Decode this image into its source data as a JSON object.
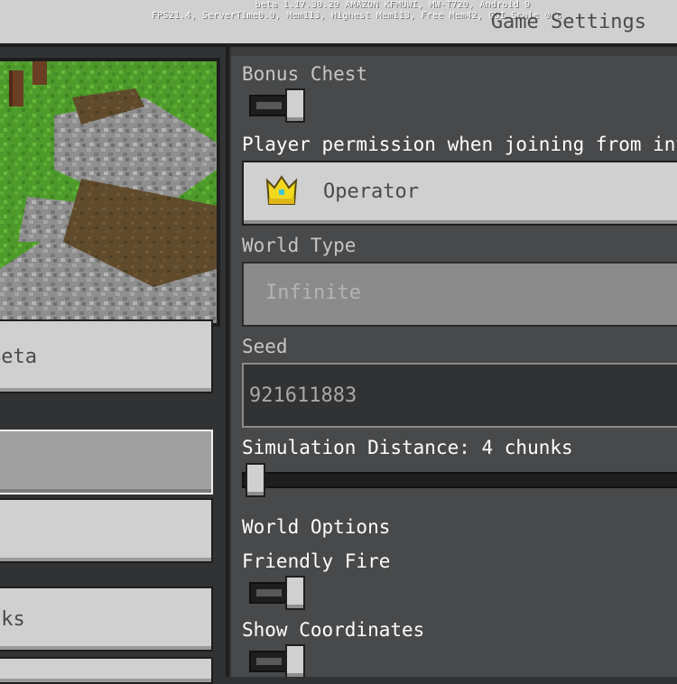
{
  "debug": {
    "line1": "beta 1.17.30.20 AMAZON KFMUWI, MW-T720, Android 9",
    "line2": "FPS21.4, ServerTime0.0, Mem113, Highest Mem113, Free Mem42, GUI Scale 0.8"
  },
  "header": {
    "title": "Game Settings"
  },
  "left": {
    "buttons": [
      {
        "label": "Beta"
      },
      {
        "label": ""
      },
      {
        "label": ""
      },
      {
        "label": "Cheats & Blocks"
      }
    ],
    "bottom_label": "cks"
  },
  "settings": {
    "bonus_chest": {
      "label": "Bonus Chest",
      "on": false
    },
    "player_permission": {
      "label": "Player permission when joining from invite",
      "value": "Operator",
      "icon": "crown-icon"
    },
    "world_type": {
      "label": "World Type",
      "value": "Infinite",
      "disabled": true
    },
    "seed": {
      "label": "Seed",
      "value": "921611883"
    },
    "simulation_distance": {
      "label": "Simulation Distance: 4 chunks",
      "level": 0
    },
    "world_options": {
      "label": "World Options"
    },
    "friendly_fire": {
      "label": "Friendly Fire",
      "on": true
    },
    "show_coordinates": {
      "label": "Show Coordinates",
      "on": true
    }
  },
  "colors": {
    "panel_bg": "#48494a",
    "button_gray": "#d0d0d0",
    "crown_gold": "#f2d91e"
  }
}
